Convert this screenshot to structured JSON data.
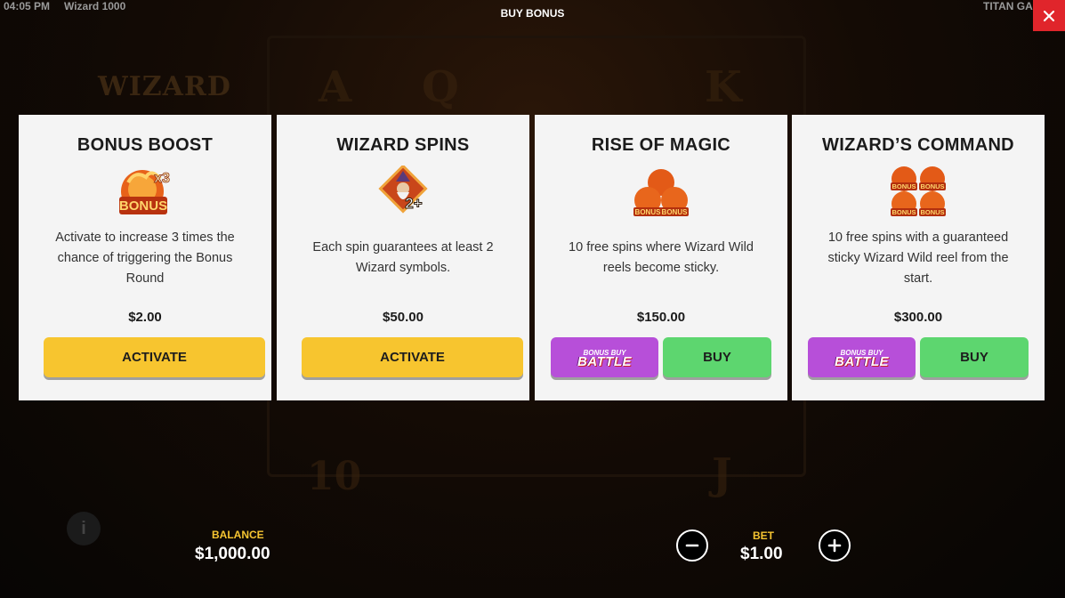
{
  "topbar": {
    "time": "04:05 PM",
    "game_name": "Wizard 1000",
    "title": "BUY BONUS",
    "brand": "TITAN GA"
  },
  "background": {
    "logo": "WIZARD",
    "symbols_top": [
      "A",
      "Q",
      "K"
    ],
    "symbols_bottom": [
      "10",
      "J"
    ]
  },
  "cards": [
    {
      "title": "BONUS BOOST",
      "icon": "bonus-x3-icon",
      "icon_text": "BONUS",
      "icon_multiplier": "x3",
      "description": "Activate to increase 3 times the chance of triggering the Bonus Round",
      "price": "$2.00",
      "activate_label": "ACTIVATE"
    },
    {
      "title": "WIZARD SPINS",
      "icon": "wizard-2plus-icon",
      "icon_text": "2+",
      "description": "Each spin guarantees at least 2 Wizard symbols.",
      "price": "$50.00",
      "activate_label": "ACTIVATE"
    },
    {
      "title": "RISE OF MAGIC",
      "icon": "three-bonus-icon",
      "icon_text": "BONUS",
      "description": "10 free spins where Wizard Wild reels become sticky.",
      "price": "$150.00",
      "battle_small": "BONUS BUY",
      "battle_big": "BATTLE",
      "buy_label": "BUY"
    },
    {
      "title": "WIZARD’S COMMAND",
      "icon": "four-bonus-icon",
      "icon_text": "BONUS",
      "description": "10 free spins with a guaranteed sticky Wizard Wild reel from the start.",
      "price": "$300.00",
      "battle_small": "BONUS BUY",
      "battle_big": "BATTLE",
      "buy_label": "BUY"
    }
  ],
  "footer": {
    "balance_label": "BALANCE",
    "balance_value": "$1,000.00",
    "bet_label": "BET",
    "bet_value": "$1.00"
  },
  "colors": {
    "activate": "#f7c52f",
    "buy": "#5dd66f",
    "battle": "#b74fd9",
    "close": "#e0252b",
    "label_gold": "#f5c431"
  }
}
